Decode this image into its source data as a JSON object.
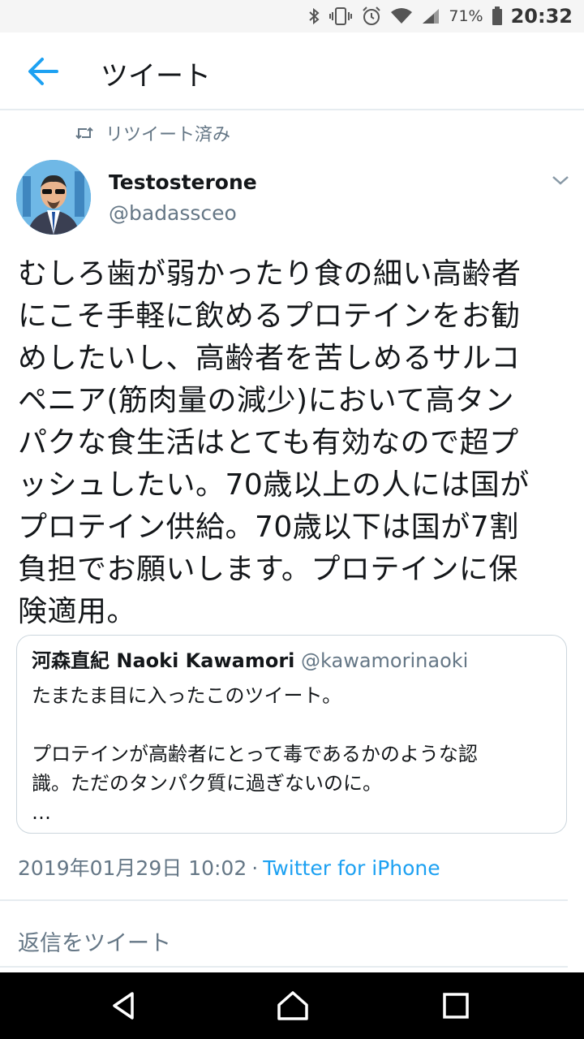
{
  "status_bar": {
    "battery_percent": "71%",
    "time": "20:32",
    "icons": [
      "bluetooth-icon",
      "vibrate-icon",
      "alarm-icon",
      "wifi-icon",
      "signal-icon",
      "battery-icon"
    ]
  },
  "header": {
    "back_icon": "arrow-left-icon",
    "title": "ツイート"
  },
  "retweet_banner": {
    "icon": "retweet-icon",
    "label": "リツイート済み"
  },
  "tweet": {
    "author_name": "Testosterone",
    "author_handle": "@badassceo",
    "menu_icon": "chevron-down-icon",
    "text": "むしろ歯が弱かったり食の細い高齢者\nにこそ手軽に飲めるプロテインをお勧\nめしたいし、高齢者を苦しめるサルコ\nペニア(筋肉量の減少)において高タン\nパクな食生活はとても有効なので超プ\nッシュしたい。70歳以上の人には国が\nプロテイン供給。70歳以下は国が7割\n負担でお願いします。プロテインに保\n険適用。",
    "timestamp": "2019年01月29日 10:02",
    "separator": "·",
    "source": "Twitter for iPhone"
  },
  "quoted_tweet": {
    "author_name": "河森直紀 Naoki Kawamori",
    "author_handle": "@kawamorinaoki",
    "text": "たまたま目に入ったこのツイート。\n\nプロテインが高齢者にとって毒であるかのような認\n識。ただのタンパク質に過ぎないのに。\n…"
  },
  "reply": {
    "placeholder": "返信をツイート"
  },
  "colors": {
    "accent": "#1da1f2",
    "secondary_text": "#657786",
    "primary_text": "#14171a",
    "border": "#e6ecf0"
  },
  "nav_bar": {
    "icons": [
      "nav-back-icon",
      "nav-home-icon",
      "nav-recents-icon"
    ]
  }
}
